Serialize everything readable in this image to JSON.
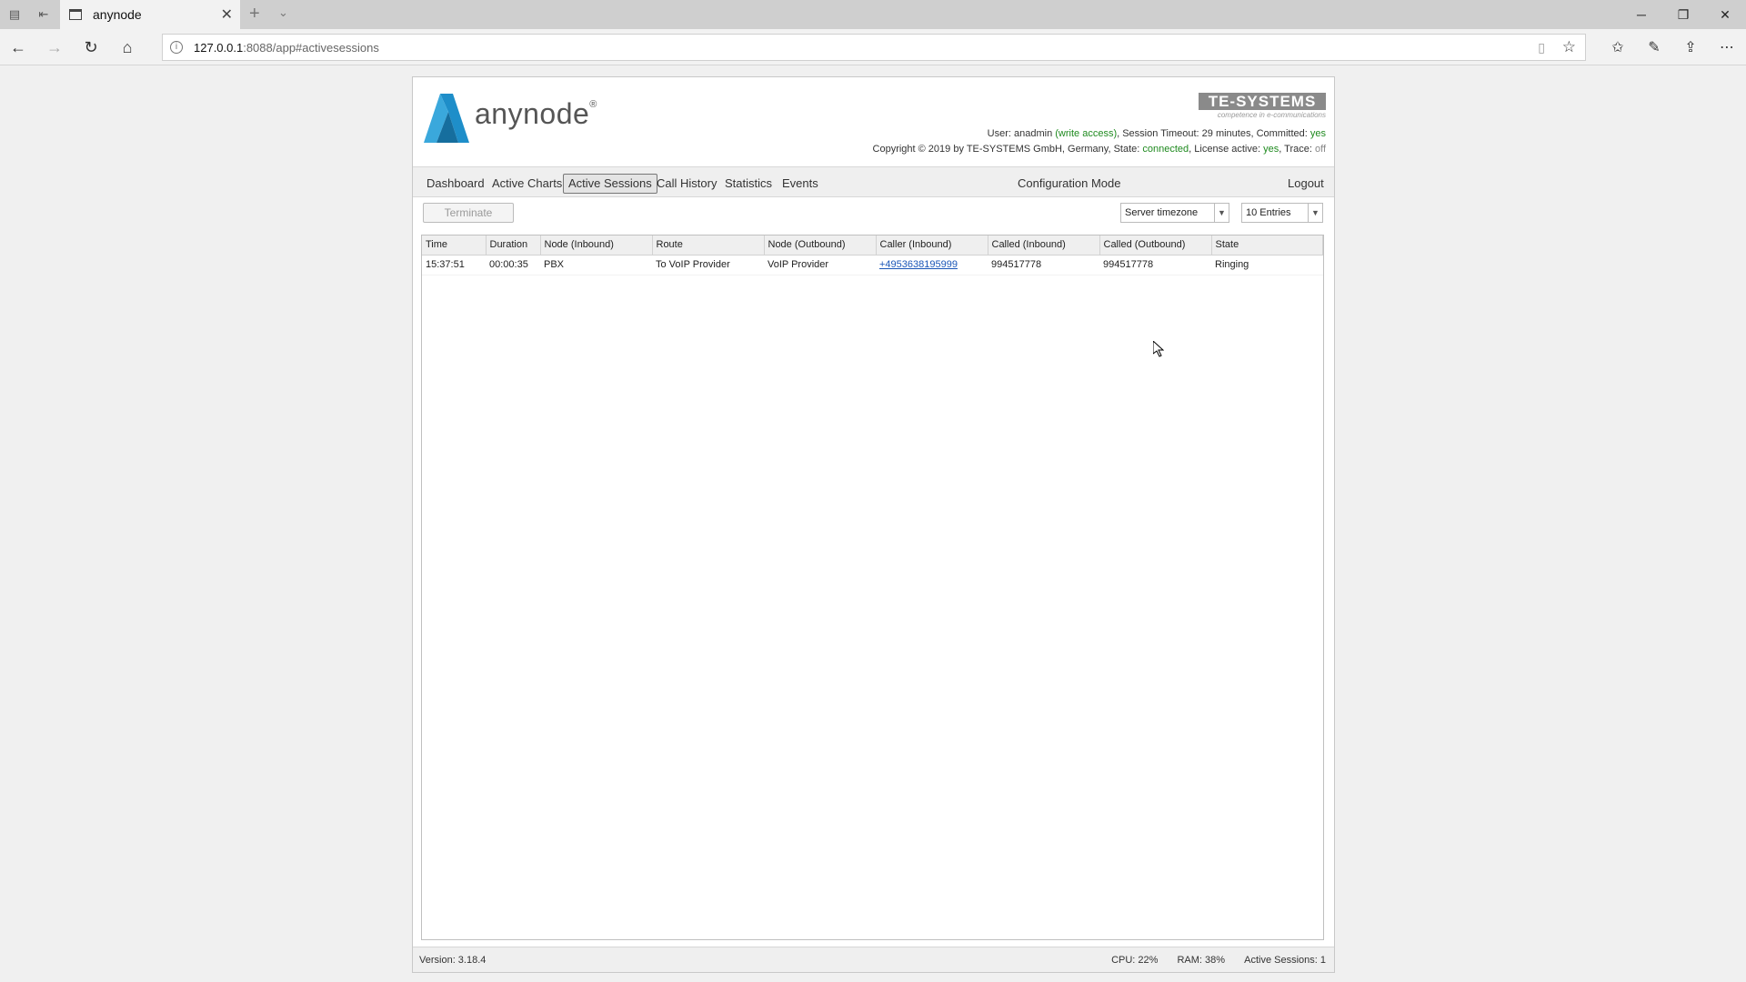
{
  "browser": {
    "tab_title": "anynode",
    "url_host": "127.0.0.1",
    "url_rest": ":8088/app#activesessions"
  },
  "header": {
    "brand": "anynode",
    "brand_mark": "®",
    "company": "TE-SYSTEMS",
    "company_tagline": "competence in e-communications",
    "user_label": "User: ",
    "user": "anadmin",
    "access": "(write access)",
    "timeout_label": ", Session Timeout: ",
    "timeout": "29 minutes",
    "committed_label": ", Committed: ",
    "committed": "yes",
    "copyright": "Copyright © 2019 by TE-SYSTEMS GmbH, Germany",
    "state_label": ", State: ",
    "state": "connected",
    "license_label": ", License active: ",
    "license": "yes",
    "trace_label": ", Trace: ",
    "trace": "off"
  },
  "menu": {
    "dashboard": "Dashboard",
    "active_charts": "Active Charts",
    "active_sessions": "Active Sessions",
    "call_history": "Call History",
    "statistics": "Statistics",
    "events": "Events",
    "config_mode": "Configuration Mode",
    "logout": "Logout"
  },
  "toolbar": {
    "terminate": "Terminate",
    "timezone": "Server timezone",
    "entries": "10 Entries"
  },
  "table": {
    "headers": [
      "Time",
      "Duration",
      "Node (Inbound)",
      "Route",
      "Node (Outbound)",
      "Caller (Inbound)",
      "Called (Inbound)",
      "Called (Outbound)",
      "State"
    ],
    "rows": [
      [
        "15:37:51",
        "00:00:35",
        "PBX",
        "To VoIP Provider",
        "VoIP Provider",
        "+4953638195999",
        "994517778",
        "994517778",
        "Ringing"
      ]
    ]
  },
  "footer": {
    "version": "Version:  3.18.4",
    "cpu": "CPU: 22%",
    "ram": "RAM: 38%",
    "sessions": "Active Sessions: 1"
  },
  "colors": {
    "accent_green": "#1f8a1f",
    "logo_blue": "#1e8ec9",
    "link_blue": "#1a56b8"
  }
}
